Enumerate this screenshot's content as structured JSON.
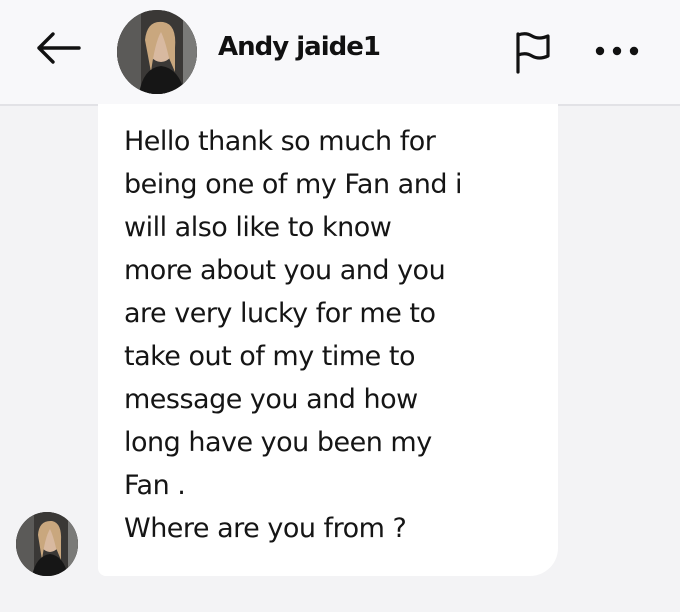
{
  "header": {
    "back_icon": "arrow-left-icon",
    "contact_name": "Andy jaide1",
    "flag_icon": "flag-icon",
    "more_icon": "more-horizontal-icon"
  },
  "message": {
    "text": "Hello thank so much for\nbeing one of my Fan and i\nwill also like to know\nmore about you and you\nare very lucky for me to\ntake out of my time to\nmessage you and how\nlong have you been my\nFan .\nWhere are you from ?"
  },
  "colors": {
    "background": "#f3f3f5",
    "bubble": "#ffffff",
    "text": "#151515"
  }
}
